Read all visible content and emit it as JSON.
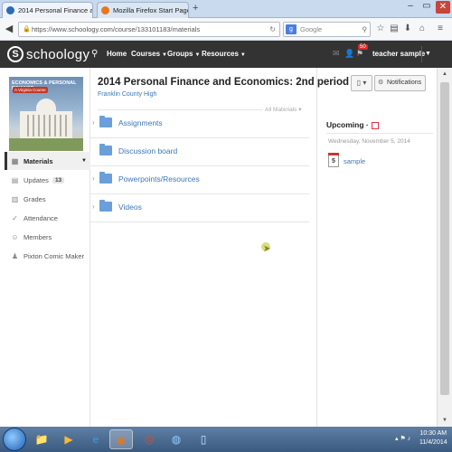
{
  "browser": {
    "tabs": [
      {
        "label": "2014 Personal Finance and ...",
        "active": true
      },
      {
        "label": "Mozilla Firefox Start Page",
        "active": false
      }
    ],
    "new_tab": "+",
    "url": "https://www.schoology.com/course/133101183/materials",
    "search_placeholder": "Google"
  },
  "header": {
    "logo_text": "schoology",
    "nav": [
      "Home",
      "Courses",
      "Groups",
      "Resources"
    ],
    "notification_count": "50",
    "username": "teacher sample"
  },
  "sidebar": {
    "items": [
      {
        "label": "Materials",
        "active": true
      },
      {
        "label": "Updates",
        "count": "13"
      },
      {
        "label": "Grades"
      },
      {
        "label": "Attendance"
      },
      {
        "label": "Members"
      },
      {
        "label": "Pixton Comic Maker"
      }
    ],
    "cover": {
      "line1": "ECONOMICS & PERSONAL FINANCE",
      "line2": "A Virginia Course"
    }
  },
  "course": {
    "title": "2014 Personal Finance and Economics: 2nd period",
    "school": "Franklin County High",
    "filter_label": "All Materials",
    "notifications_label": "Notifications",
    "folders": [
      "Assignments",
      "Discussion board",
      "Powerpoints/Resources",
      "Videos"
    ]
  },
  "upcoming": {
    "title": "Upcoming",
    "date": "Wednesday, November 5, 2014",
    "event_day": "5",
    "event_name": "sample"
  },
  "taskbar": {
    "time": "10:30 AM",
    "date": "11/4/2014"
  }
}
